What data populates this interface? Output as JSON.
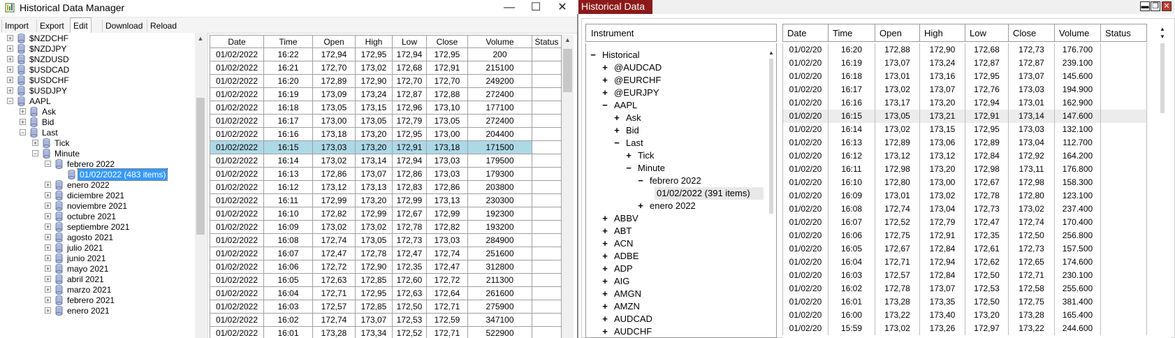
{
  "win1": {
    "title": "Historical Data Manager",
    "controls": {
      "minimize": "—",
      "maximize": "☐",
      "close": "✕"
    },
    "menu": [
      "Import",
      "Export",
      "Edit",
      "Download",
      "Reload"
    ],
    "active_menu": "Edit",
    "tree": [
      {
        "label": "$NZDCHF",
        "level": 0,
        "sign": "+"
      },
      {
        "label": "$NZDJPY",
        "level": 0,
        "sign": "+"
      },
      {
        "label": "$NZDUSD",
        "level": 0,
        "sign": "+"
      },
      {
        "label": "$USDCAD",
        "level": 0,
        "sign": "+"
      },
      {
        "label": "$USDCHF",
        "level": 0,
        "sign": "+"
      },
      {
        "label": "$USDJPY",
        "level": 0,
        "sign": "+"
      },
      {
        "label": "AAPL",
        "level": 0,
        "sign": "−"
      },
      {
        "label": "Ask",
        "level": 1,
        "sign": "+"
      },
      {
        "label": "Bid",
        "level": 1,
        "sign": "+"
      },
      {
        "label": "Last",
        "level": 1,
        "sign": "−"
      },
      {
        "label": "Tick",
        "level": 2,
        "sign": "+"
      },
      {
        "label": "Minute",
        "level": 2,
        "sign": "−"
      },
      {
        "label": "febrero 2022",
        "level": 3,
        "sign": "−"
      },
      {
        "label": "01/02/2022 (483 items)",
        "level": 4,
        "sign": "",
        "selected": true
      },
      {
        "label": "enero 2022",
        "level": 3,
        "sign": "+"
      },
      {
        "label": "diciembre 2021",
        "level": 3,
        "sign": "+"
      },
      {
        "label": "noviembre 2021",
        "level": 3,
        "sign": "+"
      },
      {
        "label": "octubre 2021",
        "level": 3,
        "sign": "+"
      },
      {
        "label": "septiembre 2021",
        "level": 3,
        "sign": "+"
      },
      {
        "label": "agosto 2021",
        "level": 3,
        "sign": "+"
      },
      {
        "label": "julio 2021",
        "level": 3,
        "sign": "+"
      },
      {
        "label": "junio 2021",
        "level": 3,
        "sign": "+"
      },
      {
        "label": "mayo 2021",
        "level": 3,
        "sign": "+"
      },
      {
        "label": "abril 2021",
        "level": 3,
        "sign": "+"
      },
      {
        "label": "marzo 2021",
        "level": 3,
        "sign": "+"
      },
      {
        "label": "febrero 2021",
        "level": 3,
        "sign": "+"
      },
      {
        "label": "enero 2021",
        "level": 3,
        "sign": "+"
      }
    ],
    "grid": {
      "columns": [
        "Date",
        "Time",
        "Open",
        "High",
        "Low",
        "Close",
        "Volume",
        "Status"
      ],
      "selected_row": 7,
      "rows": [
        [
          "01/02/2022",
          "16:22",
          "172,94",
          "172,95",
          "172,94",
          "172,95",
          "200",
          ""
        ],
        [
          "01/02/2022",
          "16:21",
          "172,70",
          "173,02",
          "172,68",
          "172,91",
          "215100",
          ""
        ],
        [
          "01/02/2022",
          "16:20",
          "172,89",
          "172,90",
          "172,70",
          "172,70",
          "249200",
          ""
        ],
        [
          "01/02/2022",
          "16:19",
          "173,09",
          "173,24",
          "172,87",
          "172,88",
          "272400",
          ""
        ],
        [
          "01/02/2022",
          "16:18",
          "173,05",
          "173,15",
          "172,96",
          "173,10",
          "177100",
          ""
        ],
        [
          "01/02/2022",
          "16:17",
          "173,00",
          "173,05",
          "172,79",
          "173,05",
          "272400",
          ""
        ],
        [
          "01/02/2022",
          "16:16",
          "173,18",
          "173,20",
          "172,95",
          "173,00",
          "204400",
          ""
        ],
        [
          "01/02/2022",
          "16:15",
          "173,03",
          "173,20",
          "172,91",
          "173,18",
          "171500",
          ""
        ],
        [
          "01/02/2022",
          "16:14",
          "173,02",
          "173,14",
          "172,94",
          "173,03",
          "179500",
          ""
        ],
        [
          "01/02/2022",
          "16:13",
          "172,86",
          "173,07",
          "172,86",
          "173,03",
          "179300",
          ""
        ],
        [
          "01/02/2022",
          "16:12",
          "173,12",
          "173,13",
          "172,83",
          "172,86",
          "203800",
          ""
        ],
        [
          "01/02/2022",
          "16:11",
          "172,99",
          "173,20",
          "172,99",
          "173,13",
          "230300",
          ""
        ],
        [
          "01/02/2022",
          "16:10",
          "172,82",
          "172,99",
          "172,67",
          "172,99",
          "192300",
          ""
        ],
        [
          "01/02/2022",
          "16:09",
          "173,02",
          "173,02",
          "172,78",
          "172,82",
          "193200",
          ""
        ],
        [
          "01/02/2022",
          "16:08",
          "172,74",
          "173,05",
          "172,73",
          "173,03",
          "284900",
          ""
        ],
        [
          "01/02/2022",
          "16:07",
          "172,47",
          "172,78",
          "172,47",
          "172,74",
          "251600",
          ""
        ],
        [
          "01/02/2022",
          "16:06",
          "172,72",
          "172,90",
          "172,35",
          "172,47",
          "312800",
          ""
        ],
        [
          "01/02/2022",
          "16:05",
          "172,63",
          "172,85",
          "172,60",
          "172,72",
          "211300",
          ""
        ],
        [
          "01/02/2022",
          "16:04",
          "172,71",
          "172,95",
          "172,63",
          "172,64",
          "261600",
          ""
        ],
        [
          "01/02/2022",
          "16:03",
          "172,57",
          "172,85",
          "172,50",
          "172,71",
          "275900",
          ""
        ],
        [
          "01/02/2022",
          "16:02",
          "172,74",
          "173,07",
          "172,53",
          "172,59",
          "347100",
          ""
        ],
        [
          "01/02/2022",
          "16:01",
          "173,28",
          "173,34",
          "172,52",
          "172,71",
          "522900",
          ""
        ]
      ]
    }
  },
  "win2": {
    "title": "Historical Data",
    "controls": {
      "minimize": "▬",
      "maximize": "❐",
      "close": "✕"
    },
    "tree_header": "Instrument",
    "tree": [
      {
        "label": "Historical",
        "level": 0,
        "sign": "−"
      },
      {
        "label": "@AUDCAD",
        "level": 1,
        "sign": "+"
      },
      {
        "label": "@EURCHF",
        "level": 1,
        "sign": "+"
      },
      {
        "label": "@EURJPY",
        "level": 1,
        "sign": "+"
      },
      {
        "label": "AAPL",
        "level": 1,
        "sign": "−"
      },
      {
        "label": "Ask",
        "level": 2,
        "sign": "+"
      },
      {
        "label": "Bid",
        "level": 2,
        "sign": "+"
      },
      {
        "label": "Last",
        "level": 2,
        "sign": "−"
      },
      {
        "label": "Tick",
        "level": 3,
        "sign": "+"
      },
      {
        "label": "Minute",
        "level": 3,
        "sign": "−"
      },
      {
        "label": "febrero 2022",
        "level": 4,
        "sign": "−"
      },
      {
        "label": "01/02/2022 (391 items)",
        "level": 6,
        "sign": "",
        "selected": true
      },
      {
        "label": "enero 2022",
        "level": 4,
        "sign": "+"
      },
      {
        "label": "ABBV",
        "level": 1,
        "sign": "+"
      },
      {
        "label": "ABT",
        "level": 1,
        "sign": "+"
      },
      {
        "label": "ACN",
        "level": 1,
        "sign": "+"
      },
      {
        "label": "ADBE",
        "level": 1,
        "sign": "+"
      },
      {
        "label": "ADP",
        "level": 1,
        "sign": "+"
      },
      {
        "label": "AIG",
        "level": 1,
        "sign": "+"
      },
      {
        "label": "AMGN",
        "level": 1,
        "sign": "+"
      },
      {
        "label": "AMZN",
        "level": 1,
        "sign": "+"
      },
      {
        "label": "AUDCAD",
        "level": 1,
        "sign": "+"
      },
      {
        "label": "AUDCHF",
        "level": 1,
        "sign": "+"
      }
    ],
    "grid": {
      "columns": [
        "Date",
        "Time",
        "Open",
        "High",
        "Low",
        "Close",
        "Volume",
        "Status"
      ],
      "selected_row": 5,
      "rows": [
        [
          "01/02/20",
          "16:20",
          "172,88",
          "172,90",
          "172,68",
          "172,73",
          "176.700",
          ""
        ],
        [
          "01/02/20",
          "16:19",
          "173,07",
          "173,24",
          "172,87",
          "172,87",
          "239.100",
          ""
        ],
        [
          "01/02/20",
          "16:18",
          "173,01",
          "173,16",
          "172,95",
          "173,07",
          "145.600",
          ""
        ],
        [
          "01/02/20",
          "16:17",
          "173,02",
          "173,07",
          "172,76",
          "173,03",
          "194.900",
          ""
        ],
        [
          "01/02/20",
          "16:16",
          "173,17",
          "173,20",
          "172,94",
          "173,01",
          "162.900",
          ""
        ],
        [
          "01/02/20",
          "16:15",
          "173,05",
          "173,21",
          "172,91",
          "173,14",
          "147.600",
          ""
        ],
        [
          "01/02/20",
          "16:14",
          "173,02",
          "173,15",
          "172,95",
          "173,03",
          "132.100",
          ""
        ],
        [
          "01/02/20",
          "16:13",
          "172,89",
          "173,06",
          "172,89",
          "173,04",
          "112.700",
          ""
        ],
        [
          "01/02/20",
          "16:12",
          "173,12",
          "173,12",
          "172,84",
          "172,92",
          "164.200",
          ""
        ],
        [
          "01/02/20",
          "16:11",
          "172,98",
          "173,20",
          "172,98",
          "173,11",
          "176.800",
          ""
        ],
        [
          "01/02/20",
          "16:10",
          "172,80",
          "173,00",
          "172,67",
          "172,98",
          "158.300",
          ""
        ],
        [
          "01/02/20",
          "16:09",
          "173,01",
          "173,02",
          "172,78",
          "172,80",
          "123.100",
          ""
        ],
        [
          "01/02/20",
          "16:08",
          "172,74",
          "173,04",
          "172,73",
          "173,02",
          "237.400",
          ""
        ],
        [
          "01/02/20",
          "16:07",
          "172,52",
          "172,79",
          "172,47",
          "172,74",
          "170.400",
          ""
        ],
        [
          "01/02/20",
          "16:06",
          "172,75",
          "172,91",
          "172,35",
          "172,50",
          "256.800",
          ""
        ],
        [
          "01/02/20",
          "16:05",
          "172,67",
          "172,84",
          "172,61",
          "172,73",
          "157.500",
          ""
        ],
        [
          "01/02/20",
          "16:04",
          "172,71",
          "172,94",
          "172,62",
          "172,65",
          "174.600",
          ""
        ],
        [
          "01/02/20",
          "16:03",
          "172,57",
          "172,84",
          "172,50",
          "172,71",
          "230.100",
          ""
        ],
        [
          "01/02/20",
          "16:02",
          "172,78",
          "173,07",
          "172,53",
          "172,58",
          "255.600",
          ""
        ],
        [
          "01/02/20",
          "16:01",
          "173,28",
          "173,35",
          "172,50",
          "172,75",
          "381.400",
          ""
        ],
        [
          "01/02/20",
          "16:00",
          "173,22",
          "173,40",
          "173,20",
          "173,28",
          "165.400",
          ""
        ],
        [
          "01/02/20",
          "15:59",
          "173,02",
          "173,26",
          "172,97",
          "173,22",
          "244.600",
          ""
        ]
      ]
    }
  }
}
